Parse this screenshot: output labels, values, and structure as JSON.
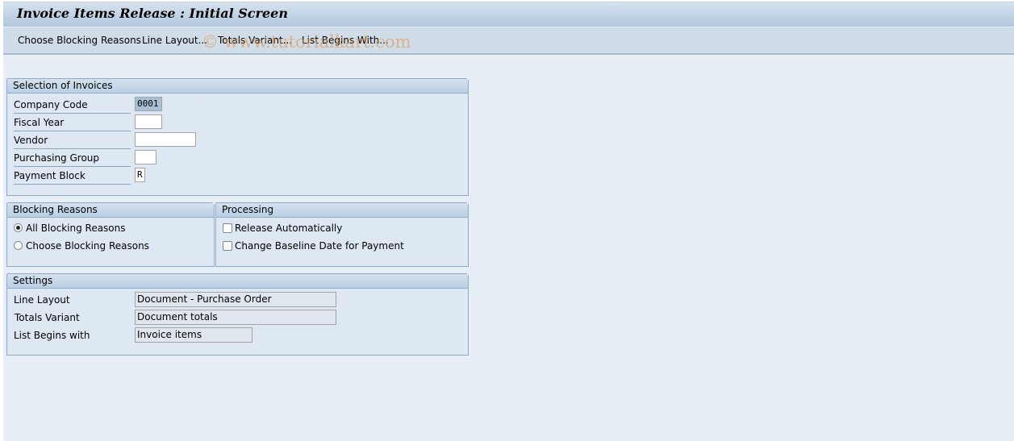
{
  "window": {
    "title": "Invoice Items Release : Initial Screen"
  },
  "toolbar": {
    "items": [
      {
        "label": "Choose Blocking Reasons"
      },
      {
        "label": "Line Layout..."
      },
      {
        "label": "Totals Variant..."
      },
      {
        "label": "List Begins With..."
      }
    ],
    "watermark": "© www.tutorialkart.com"
  },
  "selection": {
    "title": "Selection of Invoices",
    "fields": [
      {
        "label": "Company Code",
        "value": "0001"
      },
      {
        "label": "Fiscal Year",
        "value": ""
      },
      {
        "label": "Vendor",
        "value": ""
      },
      {
        "label": "Purchasing Group",
        "value": ""
      },
      {
        "label": "Payment Block",
        "value": "R"
      }
    ]
  },
  "blocking": {
    "title": "Blocking Reasons",
    "options": [
      {
        "label": "All Blocking Reasons",
        "selected": true
      },
      {
        "label": "Choose Blocking Reasons",
        "selected": false
      }
    ]
  },
  "processing": {
    "title": "Processing",
    "options": [
      {
        "label": "Release Automatically",
        "checked": false
      },
      {
        "label": "Change Baseline Date for Payment",
        "checked": false
      }
    ]
  },
  "settings": {
    "title": "Settings",
    "fields": [
      {
        "label": "Line Layout",
        "value": "Document - Purchase Order"
      },
      {
        "label": "Totals Variant",
        "value": "Document totals"
      },
      {
        "label": "List Begins with",
        "value": "Invoice items"
      }
    ]
  }
}
